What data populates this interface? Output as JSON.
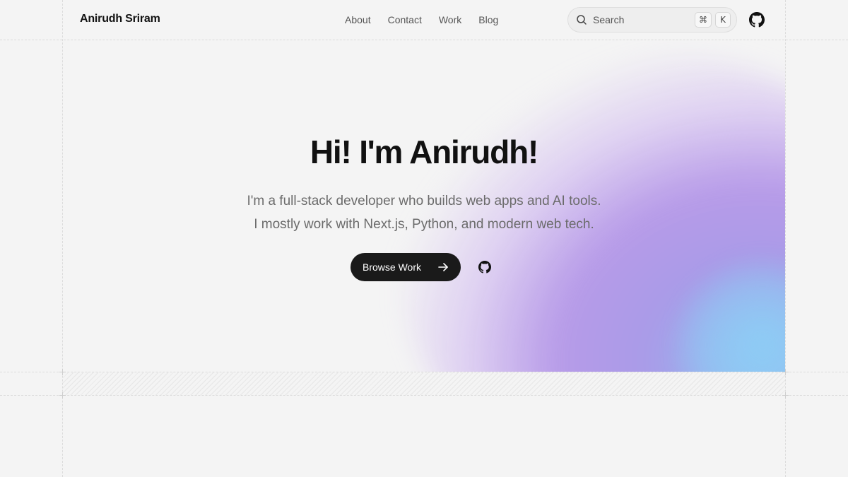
{
  "header": {
    "brand": "Anirudh Sriram",
    "nav": [
      {
        "label": "About"
      },
      {
        "label": "Contact"
      },
      {
        "label": "Work"
      },
      {
        "label": "Blog"
      }
    ],
    "search": {
      "placeholder": "Search",
      "shortcut_mod": "⌘",
      "shortcut_key": "K",
      "icon": "search-icon"
    },
    "github_icon": "github-icon"
  },
  "hero": {
    "title": "Hi! I'm Anirudh!",
    "subtitle_line1": "I'm a full-stack developer who builds web apps and AI tools.",
    "subtitle_line2": "I mostly work with Next.js, Python, and modern web tech.",
    "cta_label": "Browse Work",
    "cta_icon": "arrow-right-icon",
    "github_icon": "github-icon"
  },
  "colors": {
    "background": "#f4f4f4",
    "text": "#111111",
    "muted": "#6b6b6b",
    "button": "#1a1a1a",
    "gradient_purple": "#b79be8",
    "gradient_blue": "#8fc6f2"
  }
}
